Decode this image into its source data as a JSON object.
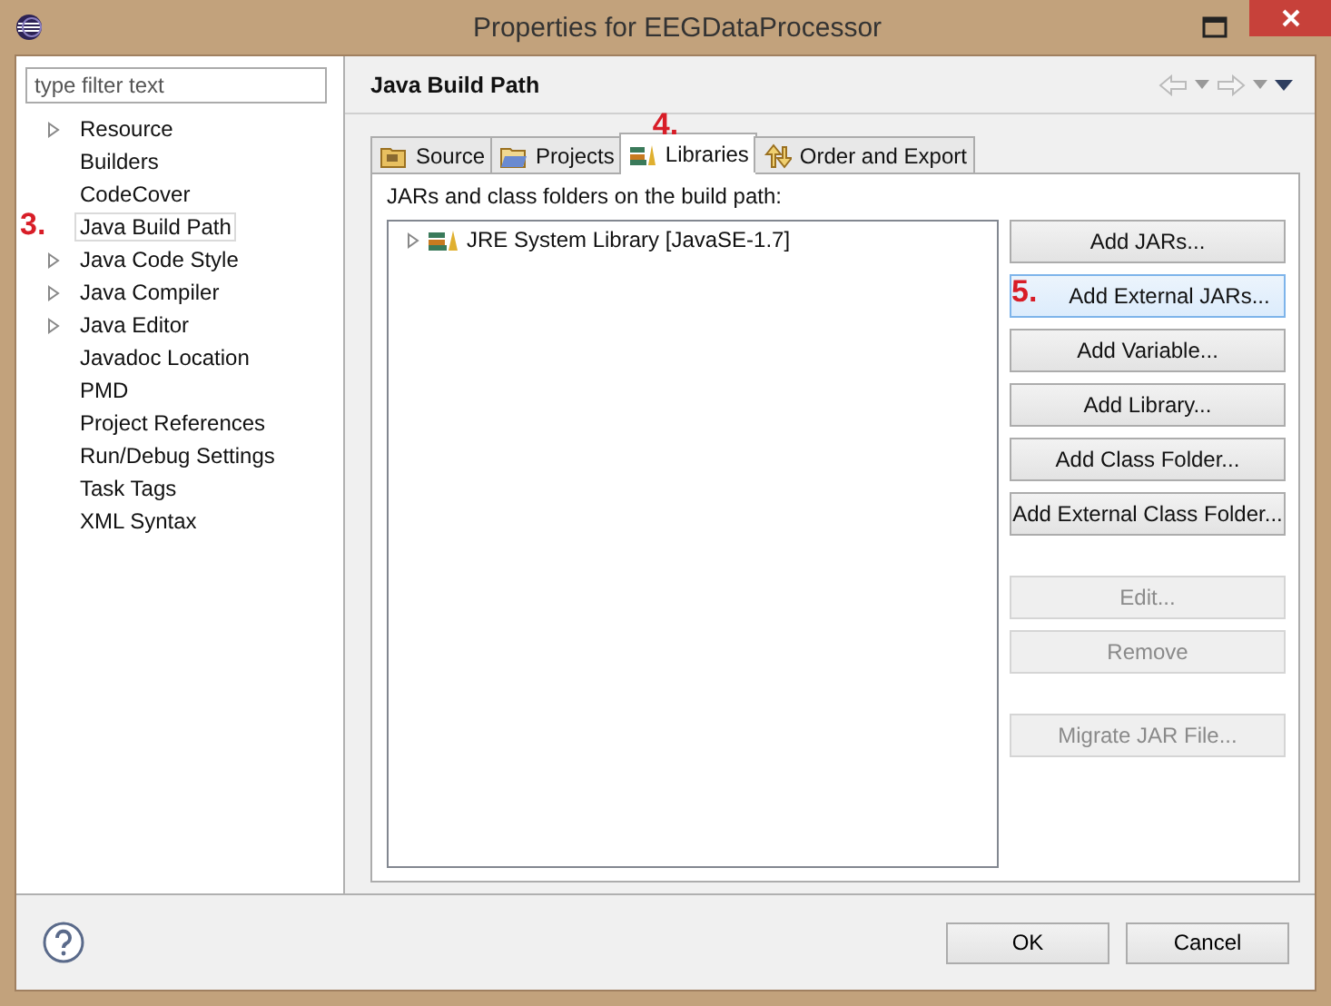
{
  "window": {
    "title": "Properties for EEGDataProcessor"
  },
  "filter": {
    "placeholder": "type filter text"
  },
  "sidebar": {
    "items": [
      {
        "label": "Resource",
        "expandable": true,
        "selected": false
      },
      {
        "label": "Builders",
        "expandable": false,
        "selected": false
      },
      {
        "label": "CodeCover",
        "expandable": false,
        "selected": false
      },
      {
        "label": "Java Build Path",
        "expandable": false,
        "selected": true,
        "step": "3."
      },
      {
        "label": "Java Code Style",
        "expandable": true,
        "selected": false
      },
      {
        "label": "Java Compiler",
        "expandable": true,
        "selected": false
      },
      {
        "label": "Java Editor",
        "expandable": true,
        "selected": false
      },
      {
        "label": "Javadoc Location",
        "expandable": false,
        "selected": false
      },
      {
        "label": "PMD",
        "expandable": false,
        "selected": false
      },
      {
        "label": "Project References",
        "expandable": false,
        "selected": false
      },
      {
        "label": "Run/Debug Settings",
        "expandable": false,
        "selected": false
      },
      {
        "label": "Task Tags",
        "expandable": false,
        "selected": false
      },
      {
        "label": "XML Syntax",
        "expandable": false,
        "selected": false
      }
    ]
  },
  "page": {
    "title": "Java Build Path"
  },
  "tabs": [
    {
      "label": "Source",
      "kind": "source",
      "selected": false
    },
    {
      "label": "Projects",
      "kind": "projects",
      "selected": false
    },
    {
      "label": "Libraries",
      "kind": "libraries",
      "selected": true,
      "step": "4."
    },
    {
      "label": "Order and Export",
      "kind": "order",
      "selected": false
    }
  ],
  "list_label": "JARs and class folders on the build path:",
  "libraries": [
    {
      "label": "JRE System Library [JavaSE-1.7]",
      "expandable": true
    }
  ],
  "button_groups": [
    {
      "buttons": [
        {
          "label": "Add JARs...",
          "disabled": false,
          "hovered": false
        },
        {
          "label": "Add External JARs...",
          "disabled": false,
          "hovered": true,
          "step": "5."
        },
        {
          "label": "Add Variable...",
          "disabled": false,
          "hovered": false
        },
        {
          "label": "Add Library...",
          "disabled": false,
          "hovered": false
        },
        {
          "label": "Add Class Folder...",
          "disabled": false,
          "hovered": false
        },
        {
          "label": "Add External Class Folder...",
          "disabled": false,
          "hovered": false
        }
      ]
    },
    {
      "buttons": [
        {
          "label": "Edit...",
          "disabled": true,
          "hovered": false
        },
        {
          "label": "Remove",
          "disabled": true,
          "hovered": false
        }
      ]
    },
    {
      "buttons": [
        {
          "label": "Migrate JAR File...",
          "disabled": true,
          "hovered": false
        }
      ]
    }
  ],
  "dialog_buttons": [
    "OK",
    "Cancel"
  ]
}
